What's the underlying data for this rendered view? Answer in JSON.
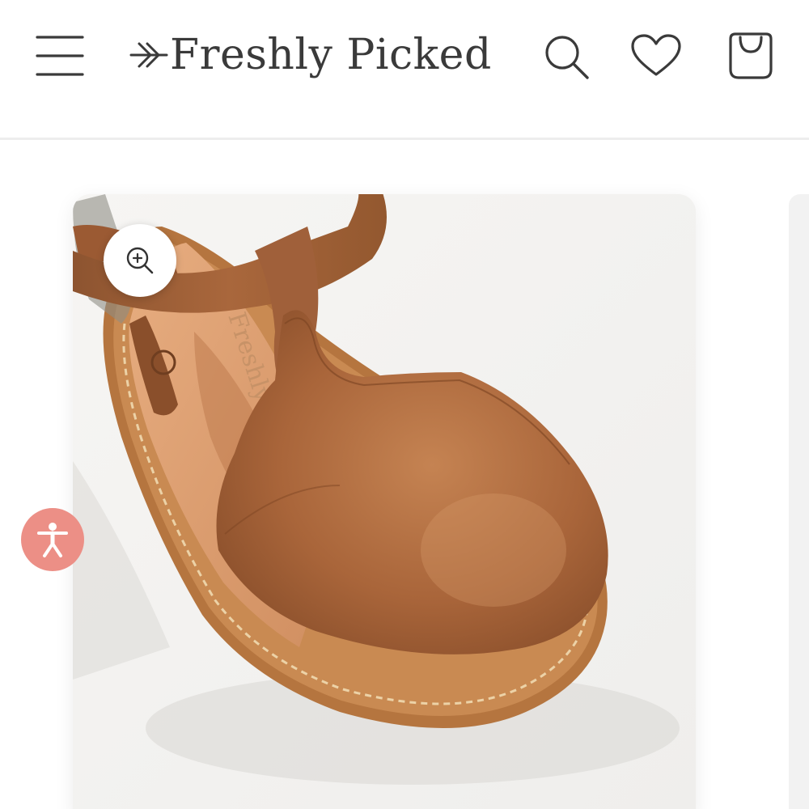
{
  "header": {
    "logo_text": "Freshly Picked",
    "icons": {
      "menu": "hamburger-menu-icon",
      "logo_mark": "arrow-logo-icon",
      "search": "search-icon",
      "wishlist": "heart-icon",
      "cart": "shopping-bag-icon"
    }
  },
  "product": {
    "image_subject": "Brown leather T-strap closed-toe sandal",
    "insole_stamp": "Freshly Picked",
    "zoom_icon": "zoom-in-icon"
  },
  "accessibility": {
    "icon": "accessibility-person-icon",
    "color": "#ec8f86"
  },
  "colors": {
    "text": "#3a3a3a",
    "leather": "#a8663c",
    "sole": "#b97a45",
    "background": "#ffffff"
  }
}
